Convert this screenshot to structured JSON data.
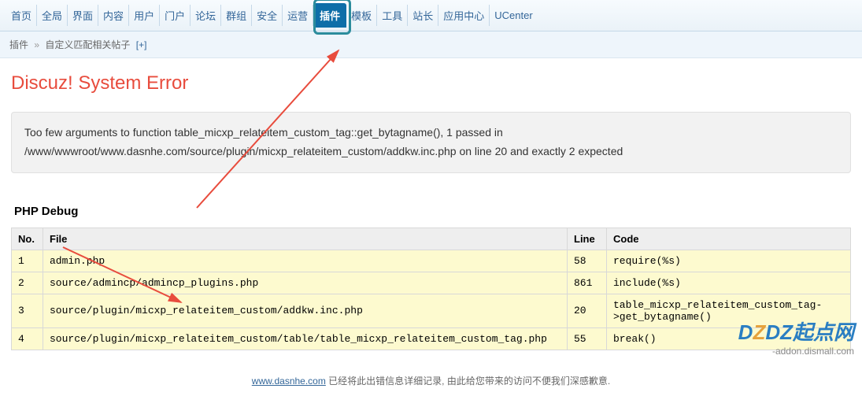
{
  "nav": {
    "items": [
      "首页",
      "全局",
      "界面",
      "内容",
      "用户",
      "门户",
      "论坛",
      "群组",
      "安全",
      "运营",
      "插件",
      "模板",
      "工具",
      "站长",
      "应用中心",
      "UCenter"
    ],
    "active_index": 10
  },
  "breadcrumb": {
    "crumb1": "插件",
    "sep": "»",
    "crumb2": "自定义匹配相关帖子",
    "add": "[+]"
  },
  "error": {
    "title": "Discuz! System Error",
    "message": "Too few arguments to function table_micxp_relateitem_custom_tag::get_bytagname(), 1 passed in /www/wwwroot/www.dasnhe.com/source/plugin/micxp_relateitem_custom/addkw.inc.php on line 20 and exactly 2 expected"
  },
  "debug": {
    "title": "PHP Debug",
    "headers": {
      "no": "No.",
      "file": "File",
      "line": "Line",
      "code": "Code"
    },
    "rows": [
      {
        "no": "1",
        "file": "admin.php",
        "line": "58",
        "code": "require(%s)"
      },
      {
        "no": "2",
        "file": "source/admincp/admincp_plugins.php",
        "line": "861",
        "code": "include(%s)"
      },
      {
        "no": "3",
        "file": "source/plugin/micxp_relateitem_custom/addkw.inc.php",
        "line": "20",
        "code": "table_micxp_relateitem_custom_tag->get_bytagname()"
      },
      {
        "no": "4",
        "file": "source/plugin/micxp_relateitem_custom/table/table_micxp_relateitem_custom_tag.php",
        "line": "55",
        "code": "break()"
      }
    ]
  },
  "footer": {
    "link_text": "www.dasnhe.com",
    "text": " 已经将此出错信息详细记录, 由此给您带来的访问不便我们深感歉意."
  },
  "watermark": {
    "main": "DZ起点网",
    "sub": "-addon.dismall.com"
  }
}
